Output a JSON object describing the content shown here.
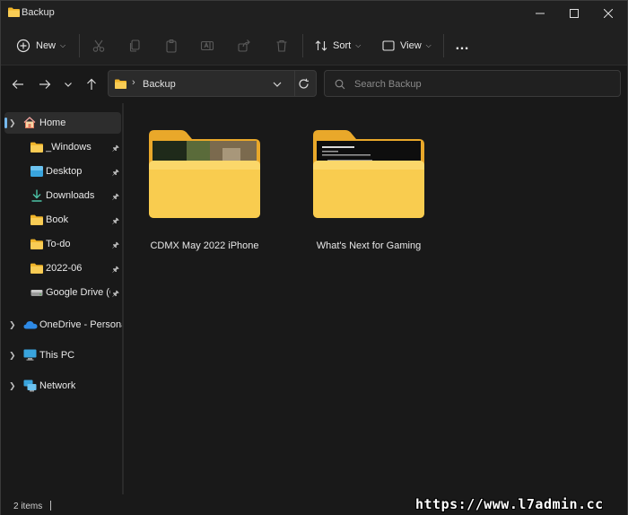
{
  "window": {
    "title": "Backup"
  },
  "command_bar": {
    "new_label": "New",
    "sort_label": "Sort",
    "view_label": "View",
    "more_label": "…"
  },
  "address": {
    "path": [
      "Backup"
    ],
    "search_placeholder": "Search Backup"
  },
  "sidebar": {
    "items": [
      {
        "label": "Home",
        "icon": "home-icon",
        "selected": true
      },
      {
        "label": "_Windows",
        "icon": "folder-icon",
        "pinned": true
      },
      {
        "label": "Desktop",
        "icon": "desktop-icon",
        "pinned": true
      },
      {
        "label": "Downloads",
        "icon": "download-icon",
        "pinned": true
      },
      {
        "label": "Book",
        "icon": "folder-icon",
        "pinned": true
      },
      {
        "label": "To-do",
        "icon": "folder-icon",
        "pinned": true
      },
      {
        "label": "2022-06",
        "icon": "folder-icon",
        "pinned": true
      },
      {
        "label": "Google Drive (G:)",
        "icon": "drive-icon",
        "pinned": true
      },
      {
        "label": "OneDrive - Personal",
        "icon": "onedrive-icon"
      },
      {
        "label": "This PC",
        "icon": "pc-icon"
      },
      {
        "label": "Network",
        "icon": "network-icon"
      }
    ]
  },
  "content": {
    "items": [
      {
        "name": "CDMX May 2022 iPhone",
        "type": "folder",
        "preview": "photo"
      },
      {
        "name": "What's Next for Gaming",
        "type": "folder",
        "preview": "document"
      }
    ]
  },
  "status": {
    "count_text": "2 items",
    "watermark": "https://www.l7admin.cc"
  },
  "colors": {
    "background": "#191919",
    "chrome": "#202020",
    "folder_yellow": "#f8c84a",
    "accent": "#76b9ed"
  }
}
